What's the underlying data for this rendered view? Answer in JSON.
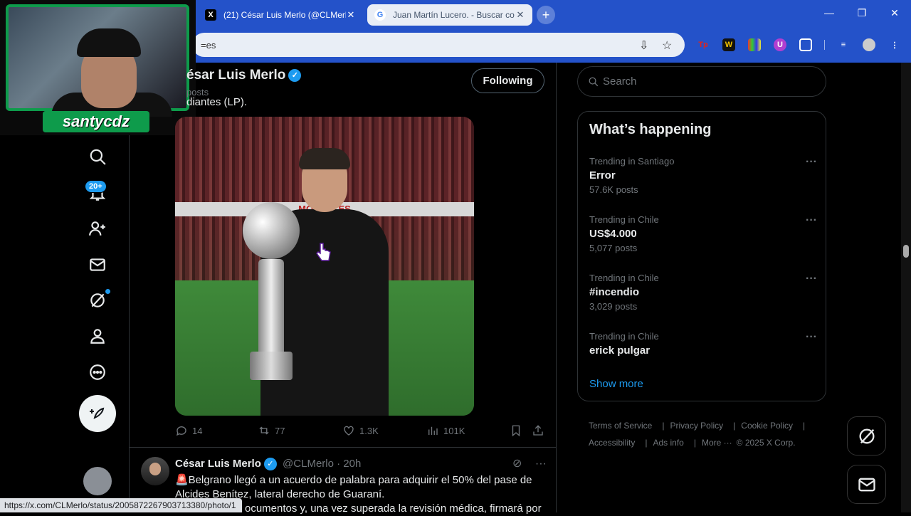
{
  "browser": {
    "tabs": [
      {
        "title": "(21) César Luis Merlo (@CLMerlo",
        "favicon": "X"
      },
      {
        "title": "Juan Martín Lucero. - Buscar co",
        "favicon": "G"
      }
    ],
    "new_tab": "+",
    "address": "=es",
    "window_controls": {
      "minimize": "—",
      "restore": "❐",
      "close": "✕"
    }
  },
  "webcam": {
    "name": "santycdz"
  },
  "profile": {
    "name": "César Luis Merlo",
    "name_visible": "ésar Luis Merlo",
    "posts": "posts",
    "following_label": "Following",
    "bio_fragment": "diantes (LP)."
  },
  "nav": {
    "notification_badge": "20+"
  },
  "tweet1": {
    "banner_text": "MOSCALES",
    "replies": "14",
    "reposts": "77",
    "likes": "1.3K",
    "views": "101K"
  },
  "tweet2": {
    "name": "César Luis Merlo",
    "handle": "@CLMerlo",
    "time": "· 20h",
    "line1": "🚨Belgrano llegó a un acuerdo de palabra para adquirir el 50% del pase de",
    "line2": "Alcides Benítez, lateral derecho de Guaraní.",
    "line3": "ocumentos y, una vez superada la revisión médica, firmará por"
  },
  "status_url": "https://x.com/CLMerlo/status/2005872267903713380/photo/1",
  "sidebar": {
    "search_placeholder": "Search",
    "heading": "What’s happening",
    "trends": [
      {
        "context": "Trending in Santiago",
        "name": "Error",
        "count": "57.6K posts"
      },
      {
        "context": "Trending in Chile",
        "name": "US$4.000",
        "count": "5,077 posts"
      },
      {
        "context": "Trending in Chile",
        "name": "#incendio",
        "count": "3,029 posts"
      },
      {
        "context": "Trending in Chile",
        "name": "erick pulgar",
        "count": ""
      }
    ],
    "show_more": "Show more",
    "footer": {
      "terms": "Terms of Service",
      "privacy": "Privacy Policy",
      "cookie": "Cookie Policy",
      "accessibility": "Accessibility",
      "ads": "Ads info",
      "more": "More ···",
      "copyright": "© 2025 X Corp."
    }
  }
}
